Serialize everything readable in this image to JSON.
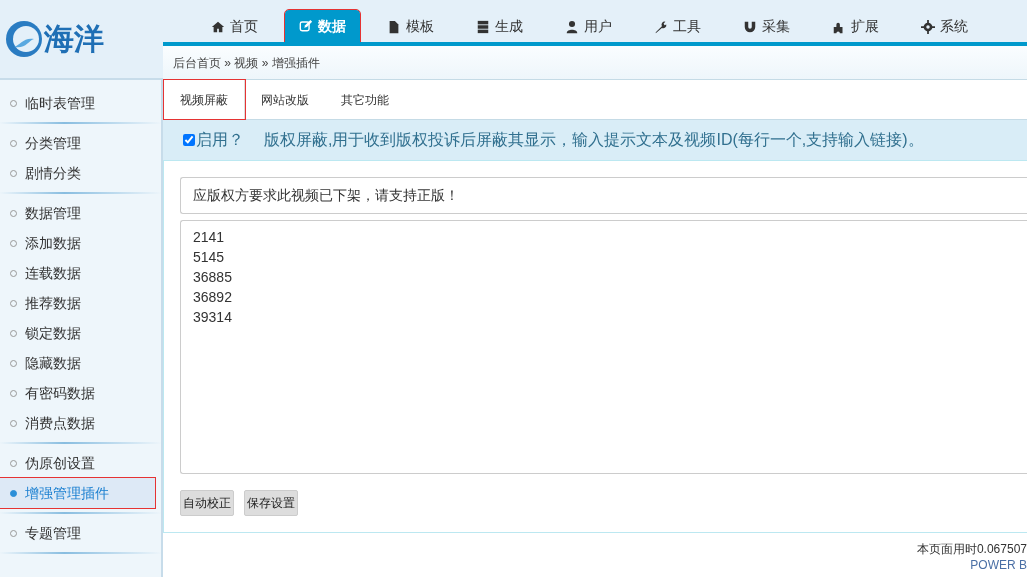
{
  "logo": {
    "text": "海洋"
  },
  "nav": [
    {
      "label": "首页",
      "selected": false,
      "highlighted": false
    },
    {
      "label": "数据",
      "selected": true,
      "highlighted": true
    },
    {
      "label": "模板",
      "selected": false,
      "highlighted": false
    },
    {
      "label": "生成",
      "selected": false,
      "highlighted": false
    },
    {
      "label": "用户",
      "selected": false,
      "highlighted": false
    },
    {
      "label": "工具",
      "selected": false,
      "highlighted": false
    },
    {
      "label": "采集",
      "selected": false,
      "highlighted": false
    },
    {
      "label": "扩展",
      "selected": false,
      "highlighted": false
    },
    {
      "label": "系统",
      "selected": false,
      "highlighted": false
    }
  ],
  "breadcrumb": "后台首页 » 视频 » 增强插件",
  "sidebar": {
    "groups": [
      {
        "items": [
          {
            "label": "临时表管理",
            "selected": false,
            "highlighted": false
          }
        ]
      },
      {
        "items": [
          {
            "label": "分类管理",
            "selected": false,
            "highlighted": false
          },
          {
            "label": "剧情分类",
            "selected": false,
            "highlighted": false
          }
        ]
      },
      {
        "items": [
          {
            "label": "数据管理",
            "selected": false,
            "highlighted": false
          },
          {
            "label": "添加数据",
            "selected": false,
            "highlighted": false
          },
          {
            "label": "连载数据",
            "selected": false,
            "highlighted": false
          },
          {
            "label": "推荐数据",
            "selected": false,
            "highlighted": false
          },
          {
            "label": "锁定数据",
            "selected": false,
            "highlighted": false
          },
          {
            "label": "隐藏数据",
            "selected": false,
            "highlighted": false
          },
          {
            "label": "有密码数据",
            "selected": false,
            "highlighted": false
          },
          {
            "label": "消费点数据",
            "selected": false,
            "highlighted": false
          }
        ]
      },
      {
        "items": [
          {
            "label": "伪原创设置",
            "selected": false,
            "highlighted": false
          },
          {
            "label": "增强管理插件",
            "selected": true,
            "highlighted": true
          }
        ]
      },
      {
        "items": [
          {
            "label": "专题管理",
            "selected": false,
            "highlighted": false
          }
        ]
      }
    ]
  },
  "tabs": [
    {
      "label": "视频屏蔽",
      "selected": true,
      "highlighted": true
    },
    {
      "label": "网站改版",
      "selected": false,
      "highlighted": false
    },
    {
      "label": "其它功能",
      "selected": false,
      "highlighted": false
    }
  ],
  "enable": {
    "label": "启用？",
    "checked": true
  },
  "description": "版权屏蔽,用于收到版权投诉后屏蔽其显示，输入提示文本及视频ID(每行一个,支持输入链接)。",
  "notice_field": {
    "value": "应版权方要求此视频已下架，请支持正版！"
  },
  "ids_field": {
    "value": "2141\n5145\n36885\n36892\n39314"
  },
  "buttons": [
    "自动校正",
    "保存设置"
  ],
  "footer": {
    "timing": "本页面用时0.067507",
    "power": "POWER B"
  }
}
